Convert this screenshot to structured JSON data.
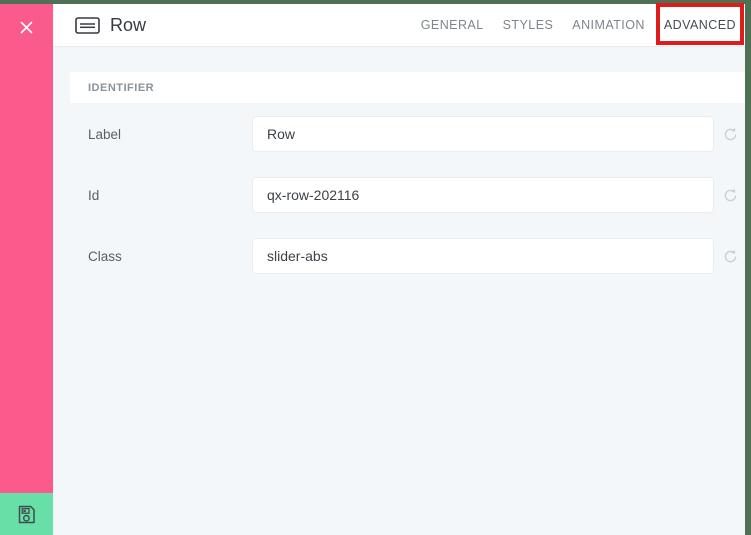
{
  "header": {
    "title": "Row",
    "tabs": [
      {
        "label": "GENERAL",
        "active": false
      },
      {
        "label": "STYLES",
        "active": false
      },
      {
        "label": "ANIMATION",
        "active": false
      },
      {
        "label": "ADVANCED",
        "active": true,
        "annotated": true
      }
    ]
  },
  "section": {
    "title": "IDENTIFIER"
  },
  "form": {
    "fields": [
      {
        "label": "Label",
        "value": "Row"
      },
      {
        "label": "Id",
        "value": "qx-row-202116"
      },
      {
        "label": "Class",
        "value": "slider-abs"
      }
    ]
  },
  "icons": {
    "close_icon": "white diagonal cross",
    "save_icon": "floppy disk outline",
    "row_icon": "rounded rectangle with inner bar",
    "refresh_icon": "circular clockwise arrow"
  },
  "colors": {
    "sidebar_pink": "#fa5a8c",
    "frame_green": "#4d7152",
    "save_button_mint": "#68dfa6",
    "content_background": "#f4f7fa",
    "panel_white": "#ffffff",
    "annotation_red": "#de1c1c",
    "tab_inactive": "#7d868d",
    "tab_active": "#454c52",
    "refresh_icon_gray": "#c9ced3"
  }
}
